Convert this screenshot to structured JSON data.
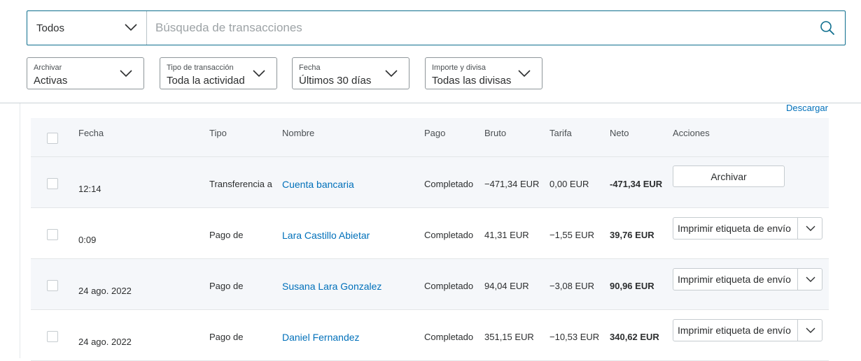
{
  "search": {
    "scope_label": "Todos",
    "placeholder": "Búsqueda de transacciones",
    "value": ""
  },
  "filters": [
    {
      "label": "Archivar",
      "value": "Activas"
    },
    {
      "label": "Tipo de transacción",
      "value": "Toda la actividad"
    },
    {
      "label": "Fecha",
      "value": "Últimos 30 días"
    },
    {
      "label": "Importe y divisa",
      "value": "Todas las divisas"
    }
  ],
  "download_label": "Descargar",
  "table": {
    "headers": {
      "date": "Fecha",
      "type": "Tipo",
      "name": "Nombre",
      "status": "Pago",
      "gross": "Bruto",
      "fee": "Tarifa",
      "net": "Neto",
      "actions": "Acciones"
    },
    "rows": [
      {
        "date": "12:14",
        "type": "Transferencia a",
        "name": "Cuenta bancaria",
        "status": "Completado",
        "gross": "−471,34 EUR",
        "fee": "0,00 EUR",
        "net": "-471,34 EUR",
        "action": "Archivar"
      },
      {
        "date": "0:09",
        "type": "Pago de",
        "name": "Lara Castillo Abietar",
        "status": "Completado",
        "gross": "41,31 EUR",
        "fee": "−1,55 EUR",
        "net": "39,76 EUR",
        "action": "Imprimir etiqueta de envío"
      },
      {
        "date": "24 ago. 2022",
        "type": "Pago de",
        "name": "Susana Lara Gonzalez",
        "status": "Completado",
        "gross": "94,04 EUR",
        "fee": "−3,08 EUR",
        "net": "90,96 EUR",
        "action": "Imprimir etiqueta de envío"
      },
      {
        "date": "24 ago. 2022",
        "type": "Pago de",
        "name": "Daniel Fernandez",
        "status": "Completado",
        "gross": "351,15 EUR",
        "fee": "−10,53 EUR",
        "net": "340,62 EUR",
        "action": "Imprimir etiqueta de envío"
      }
    ]
  },
  "colors": {
    "link": "#0070ba",
    "search_border": "#0e6e8e",
    "row_shade": "#f5f7fa"
  },
  "icons": {
    "search": "search-icon",
    "dropdown": "chevron-down-icon"
  }
}
